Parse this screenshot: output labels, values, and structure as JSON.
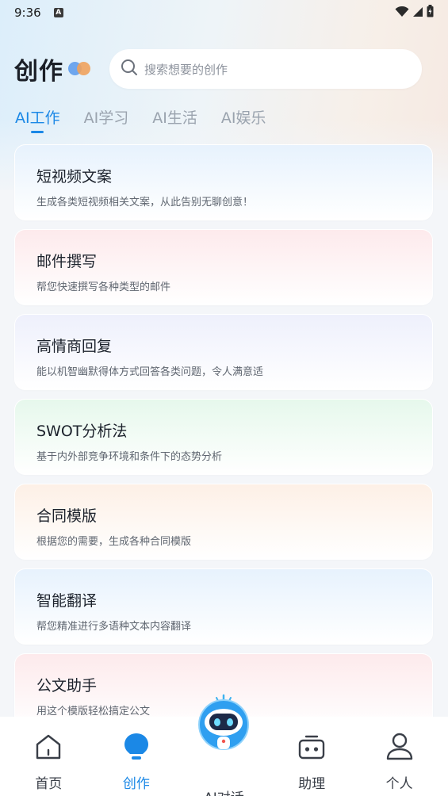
{
  "status_bar": {
    "time": "9:36",
    "badge": "A"
  },
  "header": {
    "title": "创作",
    "search_placeholder": "搜索想要的创作"
  },
  "tabs": [
    {
      "label": "AI工作",
      "active": true
    },
    {
      "label": "AI学习",
      "active": false
    },
    {
      "label": "AI生活",
      "active": false
    },
    {
      "label": "AI娱乐",
      "active": false
    }
  ],
  "cards": [
    {
      "title": "短视频文案",
      "desc": "生成各类短视频相关文案，从此告别无聊创意！",
      "tint": "#e7f2fd"
    },
    {
      "title": "邮件撰写",
      "desc": "帮您快速撰写各种类型的邮件",
      "tint": "#fdeaec"
    },
    {
      "title": "高情商回复",
      "desc": "能以机智幽默得体方式回答各类问题，令人满意适",
      "tint": "#eef0fc"
    },
    {
      "title": "SWOT分析法",
      "desc": "基于内外部竞争环境和条件下的态势分析",
      "tint": "#e6f8ec"
    },
    {
      "title": "合同模版",
      "desc": "根据您的需要，生成各种合同模版",
      "tint": "#fdf0e6"
    },
    {
      "title": "智能翻译",
      "desc": "帮您精准进行多语种文本内容翻译",
      "tint": "#e7f2fd"
    },
    {
      "title": "公文助手",
      "desc": "用这个模版轻松搞定公文",
      "tint": "#fdeaec"
    }
  ],
  "bottom_nav": [
    {
      "label": "首页",
      "icon": "home-icon",
      "active": false
    },
    {
      "label": "创作",
      "icon": "lightbulb-icon",
      "active": true
    },
    {
      "label": "AI对话",
      "icon": "robot-icon",
      "active": false
    },
    {
      "label": "助理",
      "icon": "assistant-icon",
      "active": false
    },
    {
      "label": "个人",
      "icon": "person-icon",
      "active": false
    }
  ],
  "colors": {
    "accent": "#1b88e6"
  }
}
